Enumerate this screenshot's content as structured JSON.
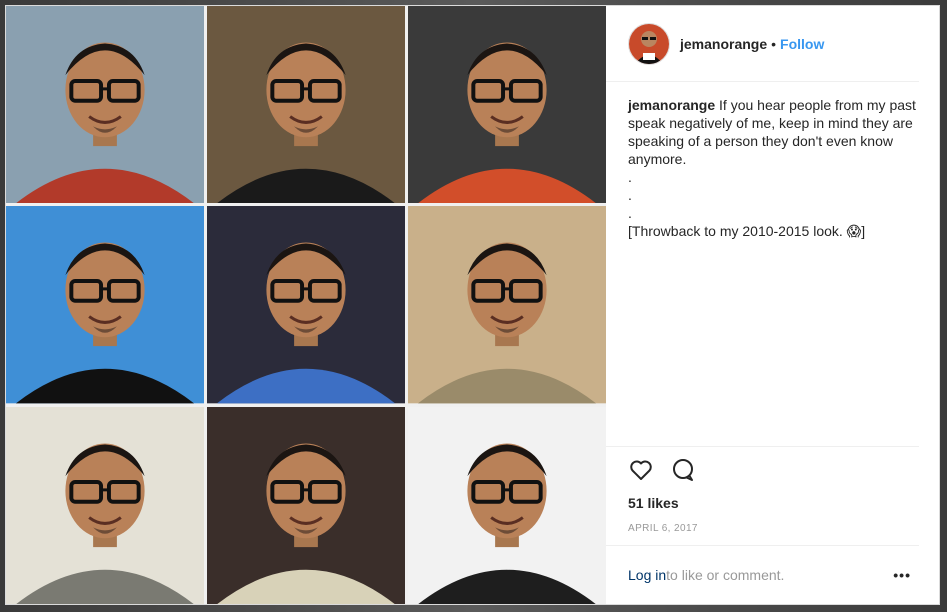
{
  "header": {
    "username": "jemanorange",
    "separator": "•",
    "follow_label": "Follow"
  },
  "caption": {
    "username": "jemanorange",
    "text": "If you hear people from my past speak negatively of me, keep in mind they are speaking of a person they don't even know anymore.\n.\n.\n.\n[Throwback to my 2010-2015 look. 😱]"
  },
  "actions": {
    "icons": [
      "heart-icon",
      "comment-icon"
    ],
    "likes": "51 likes",
    "date": "APRIL 6, 2017"
  },
  "footer": {
    "login_label": "Log in",
    "suffix": " to like or comment.",
    "more_label": "•••"
  },
  "media": {
    "tiles": [
      {
        "shirt": "#b23a2a",
        "bg": "#8aa0b0",
        "glasses": true
      },
      {
        "shirt": "#1a1a1a",
        "bg": "#6b5840",
        "glasses": true
      },
      {
        "shirt": "#d24e2a",
        "bg": "#3a3a3a",
        "glasses": true
      },
      {
        "shirt": "#111111",
        "bg": "#3f8fd6",
        "glasses": true
      },
      {
        "shirt": "#3d6fc4",
        "bg": "#2b2b3a",
        "glasses": true
      },
      {
        "shirt": "#9a8b6a",
        "bg": "#c9b08a",
        "glasses": true
      },
      {
        "shirt": "#7a7a72",
        "bg": "#e4e1d6",
        "glasses": true
      },
      {
        "shirt": "#d8d2b8",
        "bg": "#3a2e2a",
        "glasses": true
      },
      {
        "shirt": "#1e1e1e",
        "bg": "#f2f2f2",
        "glasses": true
      }
    ]
  },
  "colors": {
    "accent": "#3897f0",
    "text": "#262626",
    "muted": "#999999"
  }
}
